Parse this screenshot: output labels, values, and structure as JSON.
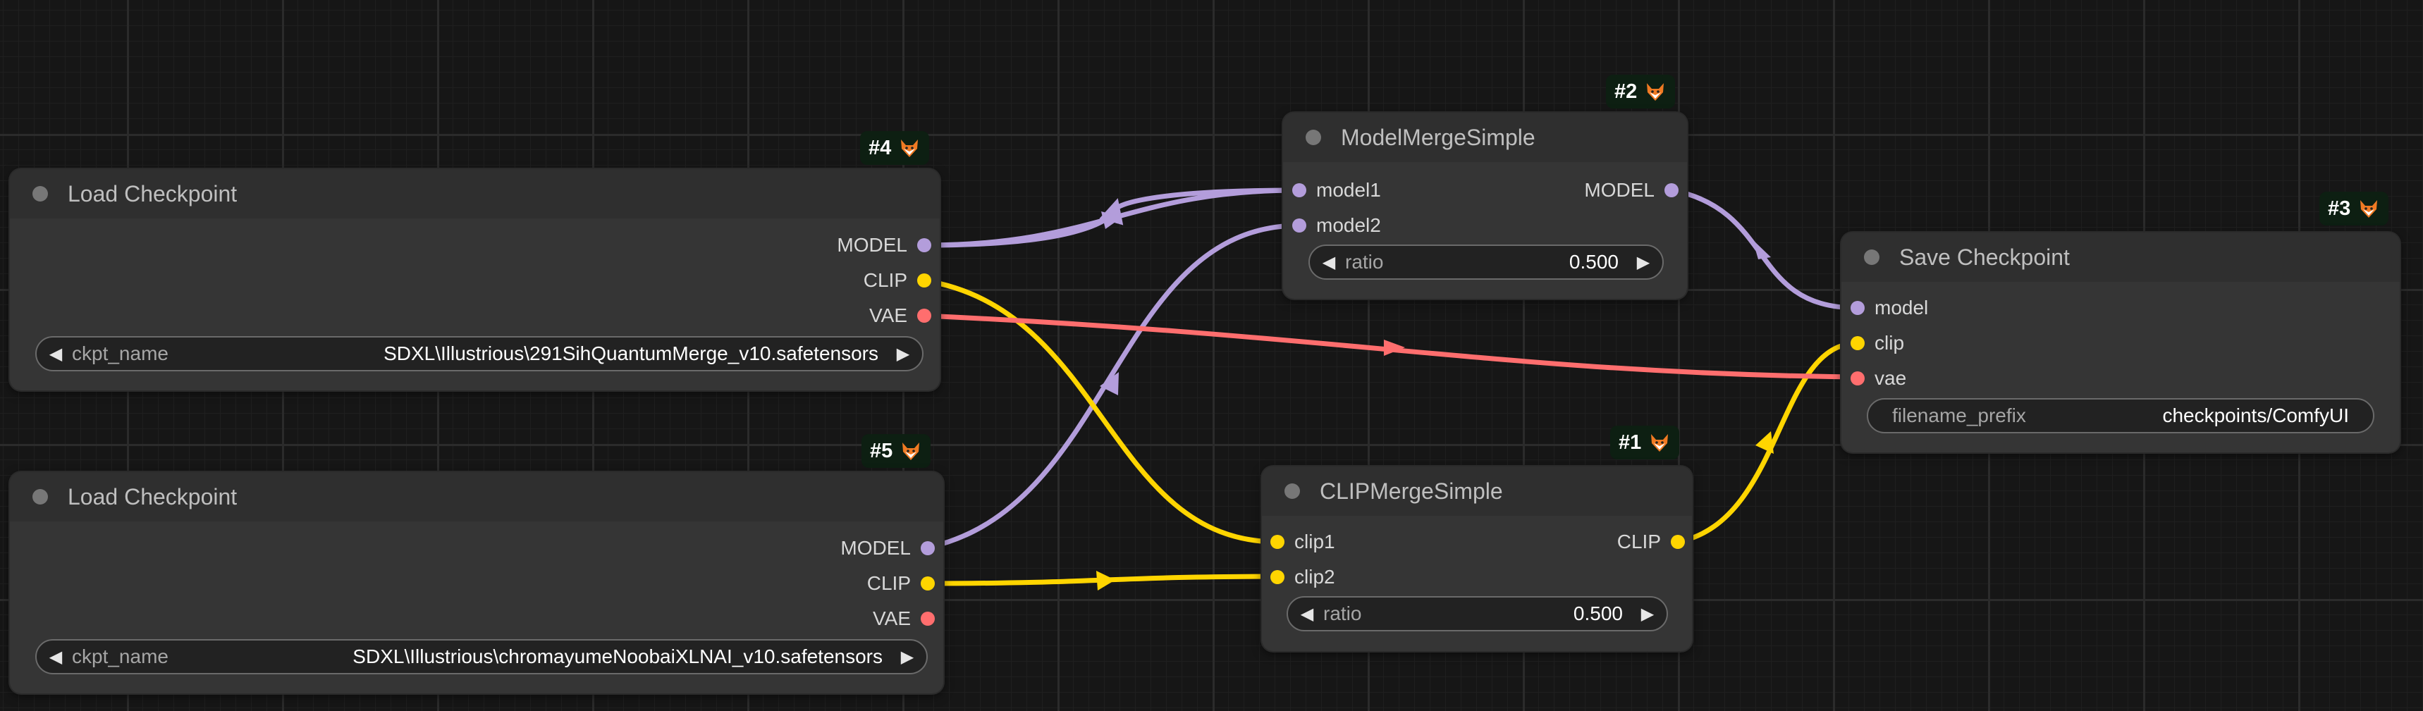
{
  "nodes": {
    "load1": {
      "title": "Load Checkpoint",
      "badge": "#4",
      "outputs": [
        "MODEL",
        "CLIP",
        "VAE"
      ],
      "widget": {
        "label": "ckpt_name",
        "value": "SDXL\\Illustrious\\291SihQuantumMerge_v10.safetensors"
      }
    },
    "load2": {
      "title": "Load Checkpoint",
      "badge": "#5",
      "outputs": [
        "MODEL",
        "CLIP",
        "VAE"
      ],
      "widget": {
        "label": "ckpt_name",
        "value": "SDXL\\Illustrious\\chromayumeNoobaiXLNAI_v10.safetensors"
      }
    },
    "modelmerge": {
      "title": "ModelMergeSimple",
      "badge": "#2",
      "inputs": [
        "model1",
        "model2"
      ],
      "output": "MODEL",
      "widget": {
        "label": "ratio",
        "value": "0.500"
      }
    },
    "clipmerge": {
      "title": "CLIPMergeSimple",
      "badge": "#1",
      "inputs": [
        "clip1",
        "clip2"
      ],
      "output": "CLIP",
      "widget": {
        "label": "ratio",
        "value": "0.500"
      }
    },
    "save": {
      "title": "Save Checkpoint",
      "badge": "#3",
      "inputs": [
        "model",
        "clip",
        "vae"
      ],
      "widget": {
        "label": "filename_prefix",
        "value": "checkpoints/ComfyUI"
      }
    }
  },
  "colors": {
    "model": "#b39ddb",
    "clip": "#ffd500",
    "vae": "#ff6e6e",
    "badge_bg": "#0d1f12",
    "node_bg": "#353535",
    "canvas_bg": "#161616"
  },
  "icons": {
    "badge": "fox-icon",
    "widget_left": "left-arrow-icon",
    "widget_right": "right-arrow-icon"
  }
}
